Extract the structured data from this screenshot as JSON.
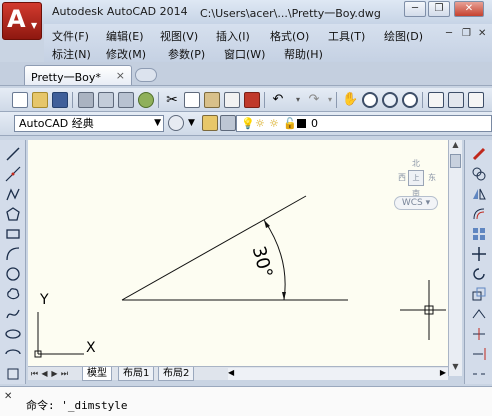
{
  "window": {
    "app_title": "Autodesk AutoCAD 2014",
    "file_path": "C:\\Users\\acer\\...\\Pretty一Boy.dwg",
    "app_button_glyph": "A"
  },
  "menu": {
    "row1": [
      "文件(F)",
      "编辑(E)",
      "视图(V)",
      "插入(I)",
      "格式(O)",
      "工具(T)",
      "绘图(D)"
    ],
    "row2": [
      "标注(N)",
      "修改(M)",
      "参数(P)",
      "窗口(W)",
      "帮助(H)"
    ]
  },
  "tabs": {
    "doc_tab": "Pretty一Boy*",
    "close": "×"
  },
  "toolbar2": {
    "workspace": "AutoCAD 经典",
    "layer_value": "0"
  },
  "viewcube": {
    "north": "北",
    "south": "南",
    "west": "西",
    "east": "东",
    "top": "上",
    "wcs": "WCS"
  },
  "drawing": {
    "angle_label": "30°",
    "ucs_y": "Y",
    "ucs_x": "X"
  },
  "layout_tabs": [
    "模型",
    "布局1",
    "布局2"
  ],
  "command": {
    "prompt": "命令:",
    "text": "'_dimstyle"
  },
  "colors": {
    "canvas_bg": "#fdfdf2",
    "app_button": "#c0281c",
    "line": "#000000"
  }
}
